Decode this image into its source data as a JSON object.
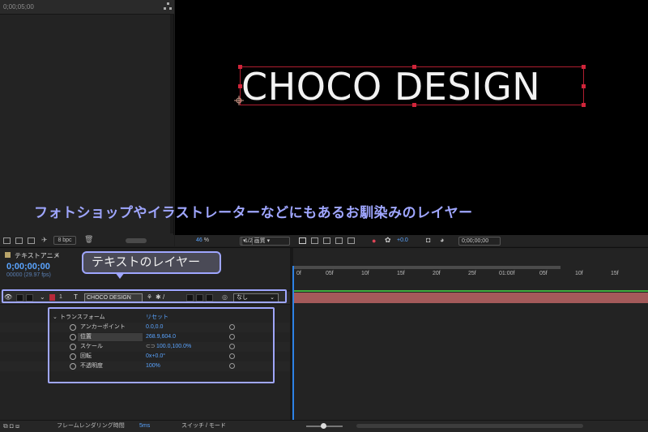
{
  "project_panel": {
    "timecode": "0;00;05;00",
    "bpc_label": "8 bpc"
  },
  "composition": {
    "text": "CHOCO DESIGN"
  },
  "annotation_main": "フォトショップやイラストレーターなどにもあるお馴染みのレイヤー",
  "viewer_toolbar": {
    "zoom_value": "46",
    "zoom_unit": "%",
    "resolution": "1/2 画質",
    "exposure": "+0.0",
    "current_time": "0;00;00;00"
  },
  "timeline": {
    "tab_label": "テキストアニメ",
    "time": "0;00;00;00",
    "frame_info": "00000 (29.97 fps)",
    "callout": "テキストのレイヤー",
    "layer": {
      "index": "1",
      "type_icon": "T",
      "name": "CHOCO DESIGN",
      "parent": "なし"
    },
    "transform": {
      "label": "トランスフォーム",
      "reset": "リセット",
      "props": [
        {
          "name": "アンカーポイント",
          "value": "0.0,0.0"
        },
        {
          "name": "位置",
          "value": "268.9,604.0"
        },
        {
          "name": "スケール",
          "value": "100.0,100.0%"
        },
        {
          "name": "回転",
          "value": "0x+0.0°"
        },
        {
          "name": "不透明度",
          "value": "100%"
        }
      ]
    },
    "ruler_ticks": [
      "0f",
      "05f",
      "10f",
      "15f",
      "20f",
      "25f",
      "01:00f",
      "05f",
      "10f",
      "15f"
    ]
  },
  "status_bar": {
    "render_label": "フレームレンダリング時間",
    "render_value": "5ms",
    "mode_toggle": "スイッチ / モード"
  }
}
